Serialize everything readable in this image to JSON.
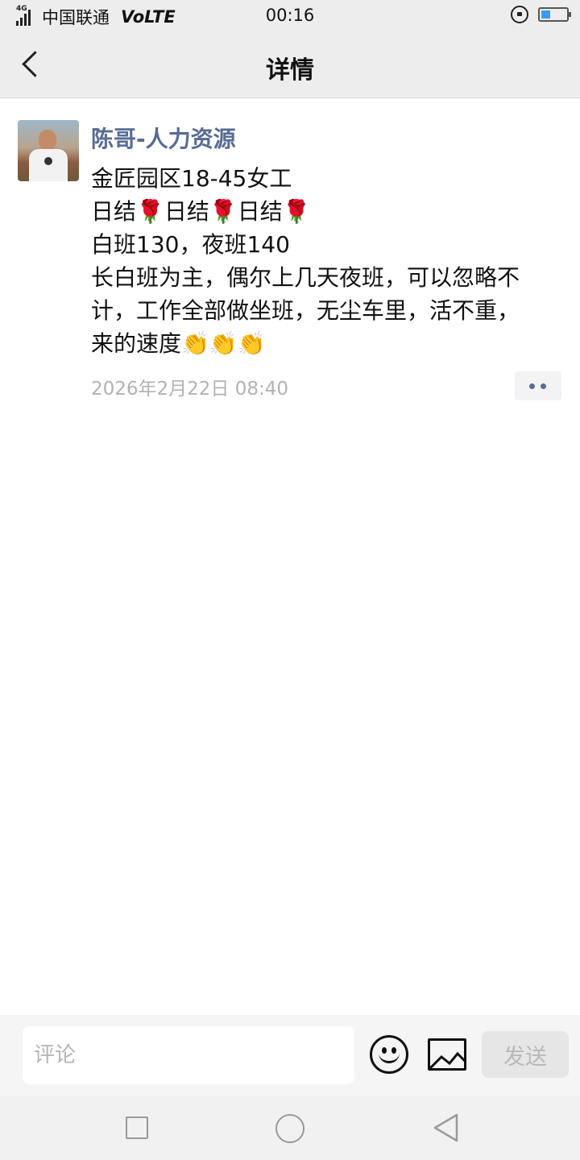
{
  "status_bar": {
    "network_type": "4G",
    "carrier": "中国联通",
    "volte": "VoLTE",
    "time": "00:16",
    "battery_level": 0.35,
    "icons": [
      "signal-icon",
      "rotation-lock-icon",
      "battery-icon"
    ]
  },
  "nav": {
    "title": "详情",
    "back_icon": "chevron-left-icon"
  },
  "post": {
    "author": "陈哥-人力资源",
    "lines": [
      "金匠园区18-45女工",
      "日结🌹日结🌹日结🌹",
      "白班130，夜班140",
      "长白班为主，偶尔上几天夜班，可以忽略不",
      "计，工作全部做坐班，无尘车里，活不重，",
      "来的速度👏👏👏"
    ],
    "timestamp": "2026年2月22日 08:40"
  },
  "comment_bar": {
    "placeholder": "评论",
    "send_label": "发送",
    "icons": [
      "emoji-icon",
      "image-icon"
    ]
  },
  "system_nav": {
    "icons": [
      "recent-apps-icon",
      "home-icon",
      "back-triangle-icon"
    ]
  }
}
